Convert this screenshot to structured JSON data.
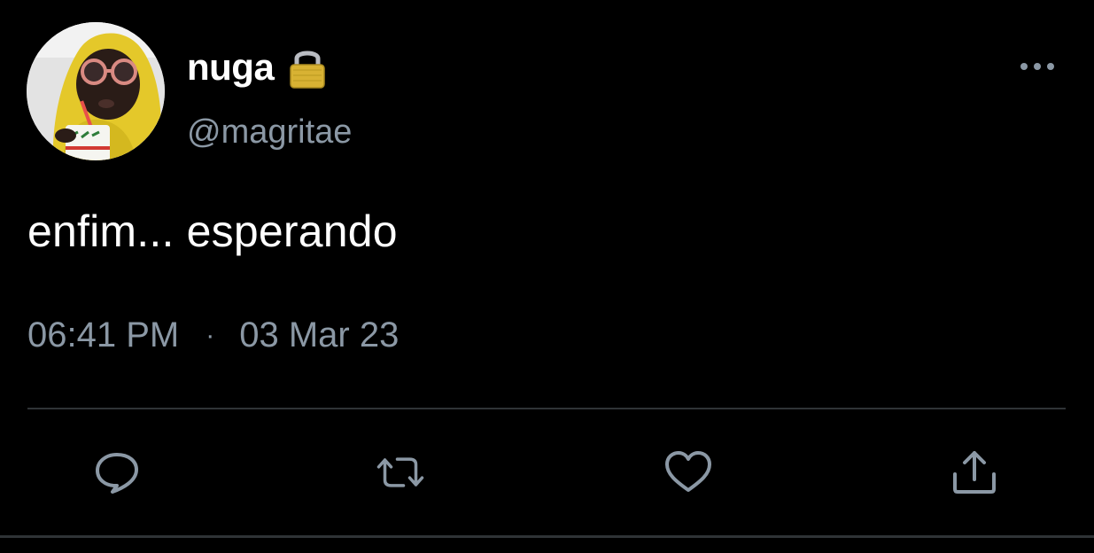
{
  "tweet": {
    "display_name": "nuga",
    "handle": "@magritae",
    "text": "enfim... esperando",
    "time": "06:41 PM",
    "separator": "·",
    "date": "03 Mar 23"
  },
  "icons": {
    "lock": "lock-icon",
    "more": "more-horizontal-icon",
    "reply": "reply-icon",
    "retweet": "retweet-icon",
    "like": "heart-icon",
    "share": "share-icon"
  },
  "colors": {
    "background": "#000000",
    "primary_text": "#ffffff",
    "secondary_text": "#8b98a5",
    "divider": "#2f3336",
    "lock_gold": "#c9a227"
  }
}
